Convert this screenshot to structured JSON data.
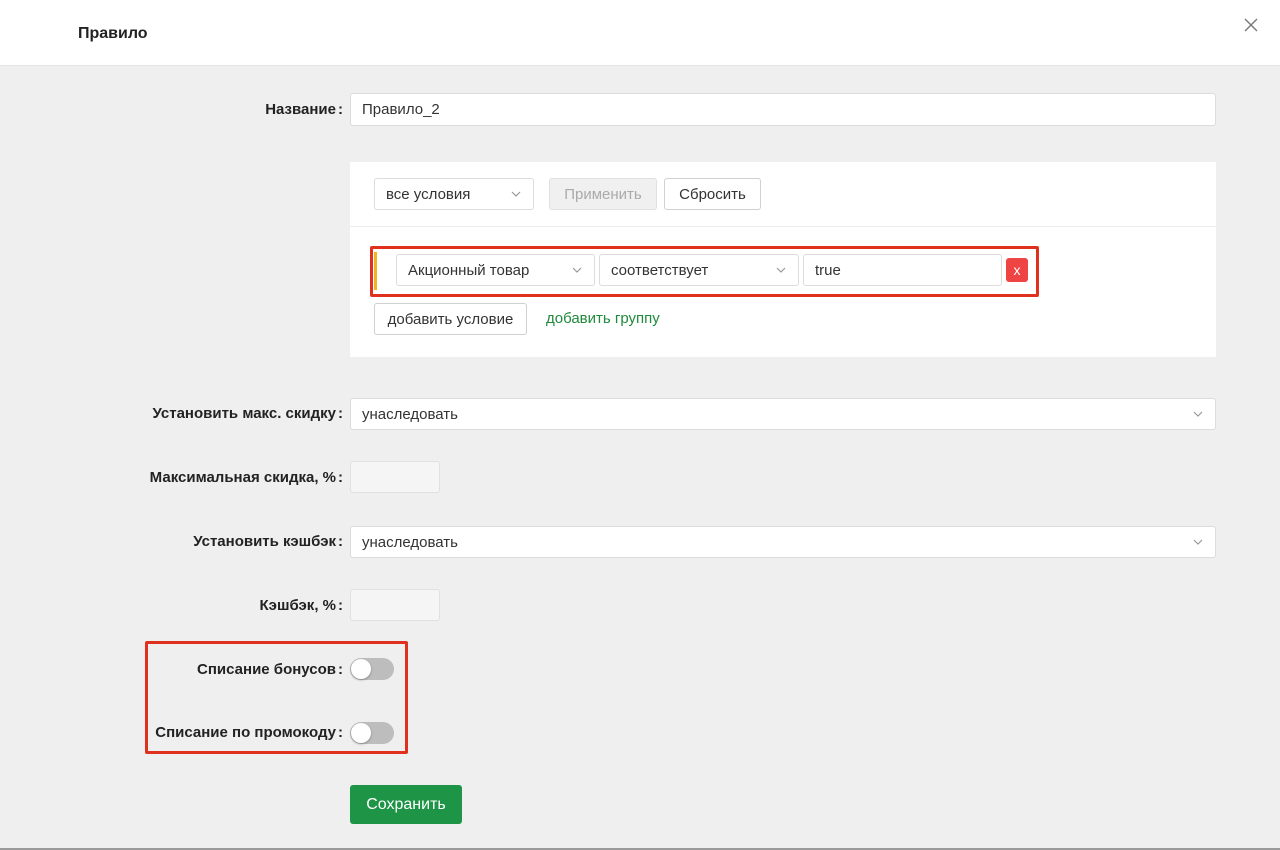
{
  "header": {
    "title": "Правило",
    "close_icon": "close-icon"
  },
  "form": {
    "name": {
      "label": "Название",
      "value": "Правило_2"
    },
    "conditions": {
      "mode": "все условия",
      "apply_label": "Применить",
      "reset_label": "Сбросить",
      "condition": {
        "field": "Акционный товар",
        "operator": "соответствует",
        "value": "true",
        "remove_label": "x"
      },
      "add_condition_label": "добавить условие",
      "add_group_label": "добавить группу"
    },
    "max_discount_mode": {
      "label": "Установить макс. скидку",
      "value": "унаследовать"
    },
    "max_discount_percent": {
      "label": "Максимальная скидка, %",
      "value": ""
    },
    "cashback_mode": {
      "label": "Установить кэшбэк",
      "value": "унаследовать"
    },
    "cashback_percent": {
      "label": "Кэшбэк, %",
      "value": ""
    },
    "bonus_writeoff": {
      "label": "Списание бонусов",
      "enabled": false
    },
    "promo_writeoff": {
      "label": "Списание по промокоду",
      "enabled": false
    },
    "colon": ":",
    "save_label": "Сохранить"
  },
  "colors": {
    "accent_green": "#1e9446",
    "link_green": "#1f8a3c",
    "highlight_red": "#e0301e",
    "remove_red": "#ef4444"
  }
}
